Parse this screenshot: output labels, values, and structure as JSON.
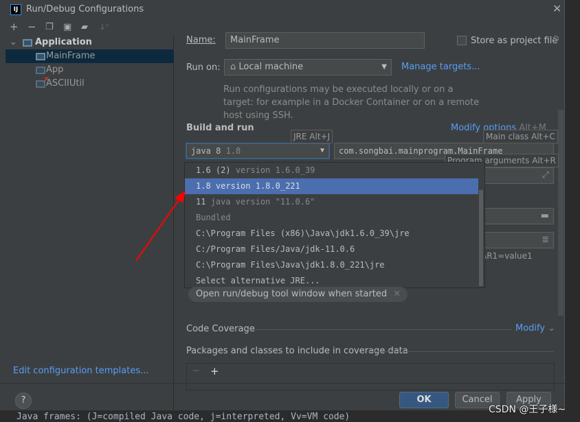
{
  "window": {
    "title": "Run/Debug Configurations",
    "logo": "IJ"
  },
  "toolbar": {
    "icons": [
      "add-icon",
      "remove-icon",
      "copy-icon",
      "save-icon",
      "new-folder-icon",
      "sort-icon"
    ]
  },
  "tree": {
    "group": "Application",
    "items": [
      {
        "label": "MainFrame",
        "selected": true
      },
      {
        "label": "App"
      },
      {
        "label": "ASCIIUtil",
        "error": true
      }
    ]
  },
  "edit_templates": "Edit configuration templates...",
  "form": {
    "name_label": "Name:",
    "name_value": "MainFrame",
    "store_label": "Store as project file",
    "store_checked": false,
    "run_on_label": "Run on:",
    "run_on_value": "Local machine",
    "manage_targets": "Manage targets...",
    "run_on_hint": "Run configurations may be executed locally or on a target: for example in a Docker Container or on a remote host using SSH.",
    "build_run": "Build and run",
    "modify_options": "Modify options",
    "modify_shortcut": "Alt+M",
    "jre_value": "java 8",
    "jre_version": "1.8",
    "main_class": "com.songbai.mainprogram.MainFrame",
    "env_partial": "AR1=value1",
    "chip": "Open run/debug tool window when started",
    "code_coverage": "Code Coverage",
    "modify": "Modify",
    "packages": "Packages and classes to include in coverage data"
  },
  "tooltips": {
    "jre": "JRE Alt+J",
    "main_class": "Main class Alt+C",
    "program_args": "Program arguments Alt+R"
  },
  "dropdown": [
    {
      "main": "1.6 (2)",
      "dim": "version 1.6.0_39"
    },
    {
      "main": "1.8",
      "dim": "version 1.8.0_221",
      "selected": true
    },
    {
      "main": "11",
      "dim": "java version \"11.0.6\""
    },
    {
      "main": "",
      "dim": "Bundled"
    },
    {
      "main": "C:\\Program Files (x86)\\Java\\jdk1.6.0_39\\jre",
      "dim": ""
    },
    {
      "main": "C:/Program Files/Java/jdk-11.0.6",
      "dim": ""
    },
    {
      "main": "C:\\Program Files\\Java\\jdk1.8.0_221\\jre",
      "dim": ""
    },
    {
      "main": "Select alternative JRE...",
      "dim": ""
    }
  ],
  "buttons": {
    "ok": "OK",
    "cancel": "Cancel",
    "apply": "Apply"
  },
  "console": "Java frames: (J=compiled Java code, j=interpreted, Vv=VM code)",
  "watermark": "CSDN @王子様~",
  "colors": {
    "bg": "#3c3f41",
    "selection": "#4b6eaf",
    "link": "#589df6",
    "tree_sel": "#0d293e",
    "annotation": "#ff0000"
  }
}
